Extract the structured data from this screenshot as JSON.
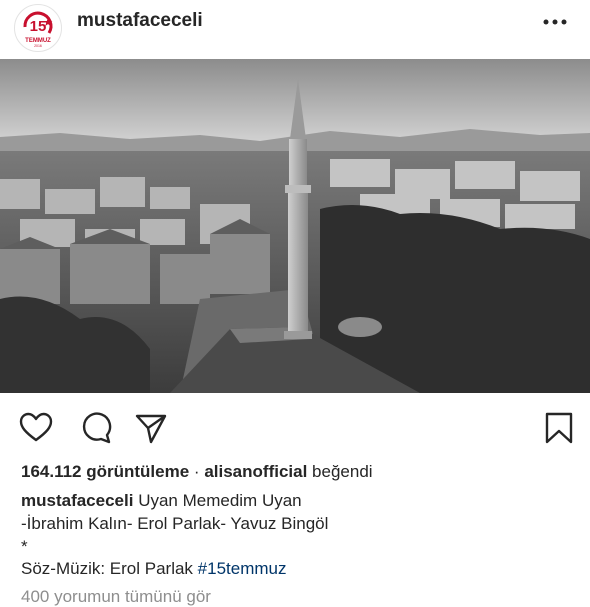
{
  "post": {
    "username": "mustafaceceli",
    "avatar_badge": {
      "number": "15",
      "text": "TEMMUZ",
      "year": "2016",
      "accent": "#c8102e"
    }
  },
  "actions": {
    "like_icon": "heart-outline-icon",
    "comment_icon": "comment-bubble-icon",
    "share_icon": "paper-plane-icon",
    "save_icon": "bookmark-outline-icon",
    "more_icon": "more-dots-icon"
  },
  "stats": {
    "views": "164.112 görüntüleme",
    "separator": "·",
    "liked_by_user": "alisanofficial",
    "liked_suffix": "beğendi"
  },
  "caption": {
    "username": "mustafaceceli",
    "title": "Uyan Memedim Uyan",
    "line2": "-İbrahim Kalın- Erol Parlak- Yavuz Bingöl",
    "line3": "*",
    "line4_text": "Söz-Müzik: Erol Parlak",
    "hashtag": "#15temmuz"
  },
  "comments_link": "400 yorumun tümünü gör",
  "colors": {
    "text": "#262626",
    "link": "#003569",
    "muted": "#8e8e8e"
  }
}
